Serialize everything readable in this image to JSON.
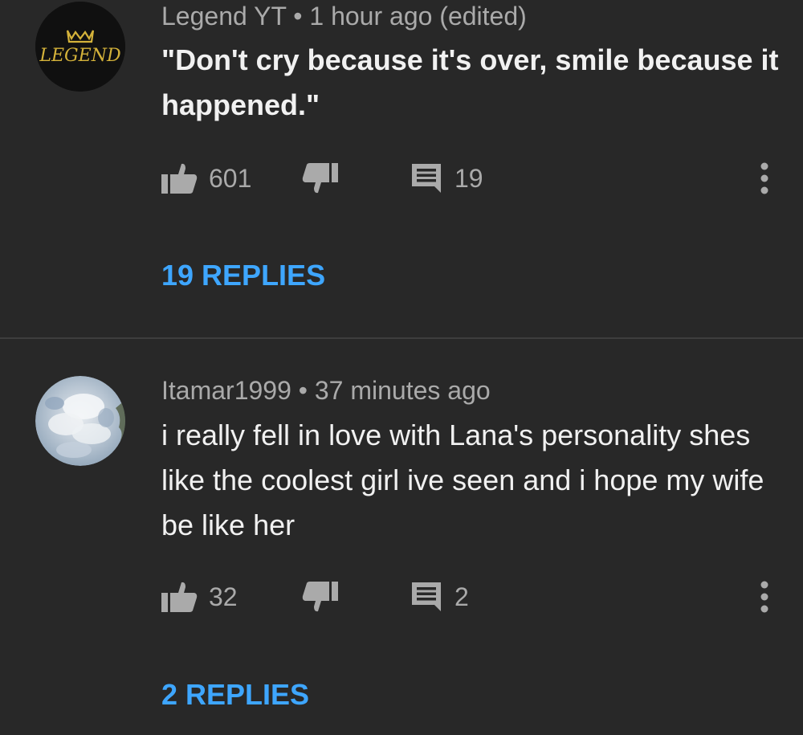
{
  "comments": [
    {
      "author": "Legend YT",
      "separator": "•",
      "time": "1 hour ago (edited)",
      "text": "\"Don't cry because it's over, smile because it happened.\"",
      "likes": "601",
      "reply_count": "19",
      "replies_label": "19 REPLIES",
      "avatar_text": "LEGEND",
      "avatar_icon": "crown-logo"
    },
    {
      "author": "Itamar1999",
      "separator": "•",
      "time": "37 minutes ago",
      "text": "i really fell in love with Lana's personality shes like the coolest girl ive seen and i hope my wife be like her",
      "likes": "32",
      "reply_count": "2",
      "replies_label": "2 REPLIES",
      "avatar_icon": "sky-clouds-photo"
    }
  ],
  "colors": {
    "background": "#282828",
    "primary_text": "#f1f1f1",
    "secondary_text": "#aaaaaa",
    "link": "#3ea6ff",
    "avatar_text": "#d4b23a"
  }
}
